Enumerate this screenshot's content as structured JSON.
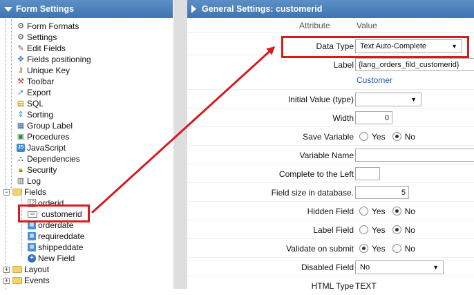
{
  "left_panel": {
    "title": "Form Settings",
    "items": [
      {
        "label": "Form Formats",
        "icon": "gear-icon"
      },
      {
        "label": "Settings",
        "icon": "gear-icon"
      },
      {
        "label": "Edit Fields",
        "icon": "pencil-icon"
      },
      {
        "label": "Fields positioning",
        "icon": "move-icon"
      },
      {
        "label": "Unique Key",
        "icon": "key-icon"
      },
      {
        "label": "Toolbar",
        "icon": "toolbar-icon"
      },
      {
        "label": "Export",
        "icon": "export-icon"
      },
      {
        "label": "SQL",
        "icon": "database-icon"
      },
      {
        "label": "Sorting",
        "icon": "sort-icon"
      },
      {
        "label": "Group Label",
        "icon": "group-label-icon"
      },
      {
        "label": "Procedures",
        "icon": "procedures-icon"
      },
      {
        "label": "JavaScript",
        "icon": "javascript-icon"
      },
      {
        "label": "Dependencies",
        "icon": "dependencies-icon"
      },
      {
        "label": "Security",
        "icon": "lock-icon"
      },
      {
        "label": "Log",
        "icon": "log-icon"
      }
    ],
    "fields_label": "Fields",
    "fields_children": [
      {
        "label": "orderid",
        "icon": "number-field-icon"
      },
      {
        "label": "customerid",
        "icon": "text-field-icon"
      },
      {
        "label": "orderdate",
        "icon": "date-field-icon"
      },
      {
        "label": "requireddate",
        "icon": "date-field-icon"
      },
      {
        "label": "shippeddate",
        "icon": "date-field-icon"
      },
      {
        "label": "New Field",
        "icon": "add-circle-icon"
      }
    ],
    "layout_label": "Layout",
    "events_label": "Events"
  },
  "right_panel": {
    "title": "General Settings: customerid",
    "col_attribute": "Attribute",
    "col_value": "Value",
    "data_type_label": "Data Type",
    "data_type_value": "Text Auto-Complete",
    "label_label": "Label",
    "label_value": "{lang_orders_fild_customerid}",
    "label_translation": "Customer",
    "initial_value_label": "Initial Value (type)",
    "initial_value_value": "",
    "width_label": "Width",
    "width_value": "0",
    "save_variable_label": "Save Variable",
    "variable_name_label": "Variable Name",
    "variable_name_value": "",
    "complete_left_label": "Complete to the Left",
    "complete_left_value": "",
    "field_size_label": "Field size in database.",
    "field_size_value": "5",
    "hidden_field_label": "Hidden Field",
    "label_field_label": "Label Field",
    "validate_label": "Validate on submit",
    "disabled_label": "Disabled Field",
    "disabled_value": "No",
    "html_type_label": "HTML Type",
    "html_type_value": "TEXT",
    "yes": "Yes",
    "no": "No"
  },
  "colors": {
    "header": "#4a7fbb",
    "highlight": "#d71920"
  }
}
